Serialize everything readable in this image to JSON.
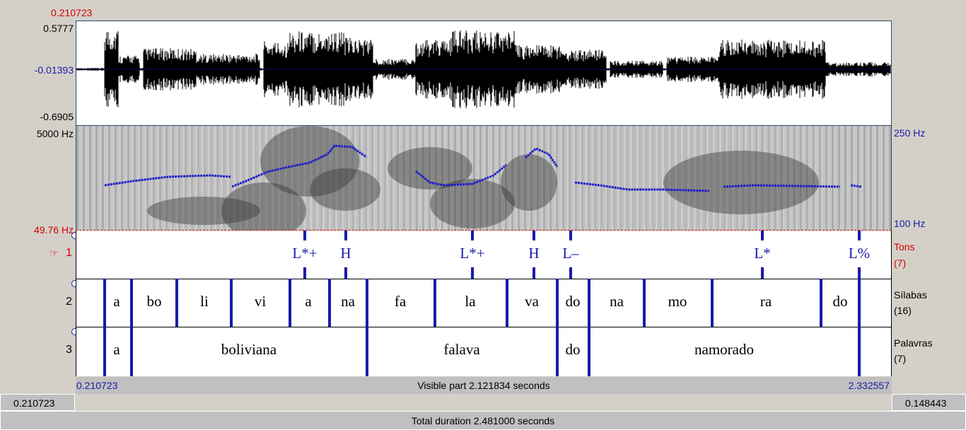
{
  "waveform": {
    "cursor_time": "0.210723",
    "amp_max": "0.5777",
    "amp_zero": "-0.01393",
    "amp_min": "-0.6905"
  },
  "spectrogram": {
    "freq_max": "5000 Hz",
    "freq_min": "49.76 Hz",
    "pitch_max": "250 Hz",
    "pitch_min": "100 Hz"
  },
  "tiers": [
    {
      "number": "1",
      "name": "Tons",
      "count": "(7)",
      "selected_icon": "pointing-hand-icon"
    },
    {
      "number": "2",
      "name": "Sílabas",
      "count": "(16)"
    },
    {
      "number": "3",
      "name": "Palavras",
      "count": "(7)"
    }
  ],
  "tones": [
    "L*+",
    "H",
    "L*+",
    "H",
    "L–",
    "L*",
    "L%"
  ],
  "syllables": [
    "a",
    "bo",
    "li",
    "vi",
    "a",
    "na",
    "fa",
    "la",
    "va",
    "do",
    "na",
    "mo",
    "ra",
    "do"
  ],
  "words": [
    "a",
    "boliviana",
    "falava",
    "do",
    "namorado"
  ],
  "visible_bar": {
    "start": "0.210723",
    "label": "Visible part 2.121834 seconds",
    "end": "2.332557"
  },
  "bottom_bar": {
    "left": "0.210723",
    "right": "0.148443",
    "total": "Total duration 2.481000 seconds"
  },
  "colors": {
    "tier_marks": "#1a1aaa",
    "axis_red": "#d40000",
    "pitch": "#1a1acc"
  }
}
